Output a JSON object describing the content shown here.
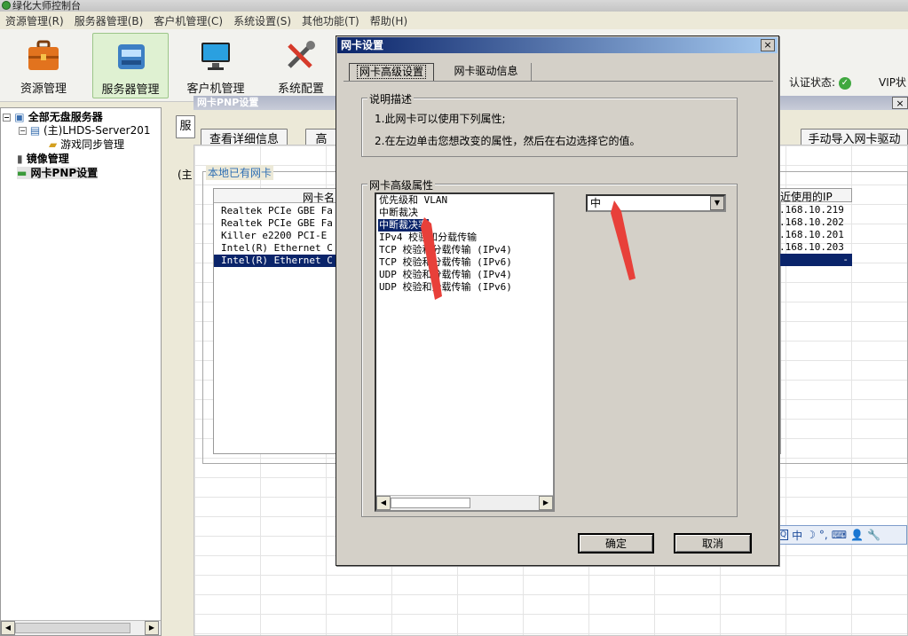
{
  "app": {
    "title": "绿化大师控制台"
  },
  "menu": [
    "资源管理(R)",
    "服务器管理(B)",
    "客户机管理(C)",
    "系统设置(S)",
    "其他功能(T)",
    "帮助(H)"
  ],
  "toolbar": {
    "buttons": [
      {
        "label": "资源管理",
        "icon": "briefcase-icon"
      },
      {
        "label": "服务器管理",
        "icon": "server-icon"
      },
      {
        "label": "客户机管理",
        "icon": "monitor-icon"
      },
      {
        "label": "系统配置",
        "icon": "tools-icon"
      }
    ],
    "auth_label": "认证状态:",
    "vip_label": "VIP状"
  },
  "tree": {
    "root": "全部无盘服务器",
    "server": "(主)LHDS-Server201",
    "game_sync": "游戏同步管理",
    "image_mgmt": "镜像管理",
    "nic_pnp": "网卡PNP设置"
  },
  "pnp_window": {
    "title": "网卡PNP设置",
    "server_select": "服",
    "btn_details": "查看详细信息",
    "btn_advanced": "高",
    "btn_import": "手动导入网卡驱动",
    "row_label": "(主",
    "group_title": "本地已有网卡",
    "col_name": "网卡名",
    "col_ip": "近使用的IP",
    "rows": [
      {
        "name": "Realtek PCIe GBE Fa",
        "ip": ".168.10.219"
      },
      {
        "name": "Realtek PCIe GBE Fa",
        "ip": ".168.10.202"
      },
      {
        "name": "Killer e2200 PCI-E",
        "ip": ".168.10.201"
      },
      {
        "name": "Intel(R) Ethernet C",
        "ip": ".168.10.203"
      },
      {
        "name": "Intel(R) Ethernet C",
        "ip": "-"
      }
    ]
  },
  "ime": {
    "mode": "中",
    "items": [
      "中",
      "☽",
      "°,",
      "⌨",
      "👤",
      "🔧"
    ]
  },
  "dialog": {
    "title": "网卡设置",
    "tabs": [
      "网卡高级设置",
      "网卡驱动信息"
    ],
    "desc_title": "说明描述",
    "desc_lines": [
      "1.此网卡可以使用下列属性;",
      "2.在左边单击您想改变的属性，然后在右边选择它的值。"
    ],
    "props_title": "网卡高级属性",
    "properties": [
      "优先级和 VLAN",
      "中断裁决",
      "中断裁决率",
      "IPv4 校验和分载传输",
      "TCP 校验和分载传输 (IPv4)",
      "TCP 校验和分载传输 (IPv6)",
      "UDP 校验和分载传输 (IPv4)",
      "UDP 校验和分载传输 (IPv6)"
    ],
    "selected_property_index": 2,
    "value": "中",
    "ok": "确定",
    "cancel": "取消"
  },
  "colors": {
    "accent_green": "#3fa83f",
    "selection": "#0a246a",
    "annotation_arrow": "#e8403a"
  }
}
